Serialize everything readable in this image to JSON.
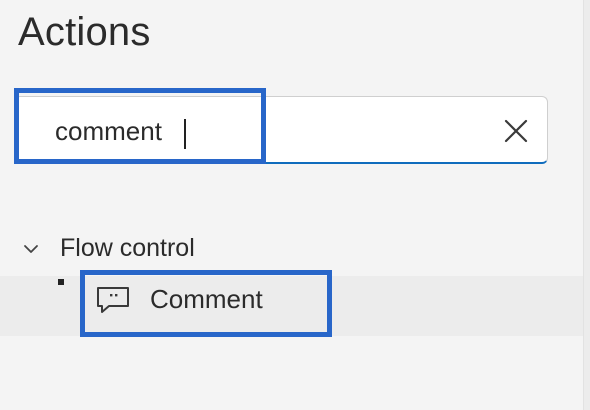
{
  "panel": {
    "title": "Actions"
  },
  "search": {
    "value": "comment",
    "clear_icon": "close-icon"
  },
  "categories": [
    {
      "label": "Flow control",
      "expanded": true,
      "items": [
        {
          "label": "Comment",
          "icon": "comment-icon"
        }
      ]
    }
  ],
  "colors": {
    "highlight": "#2866c9",
    "focus_underline": "#0f6cbd",
    "text": "#2b2b2b"
  }
}
